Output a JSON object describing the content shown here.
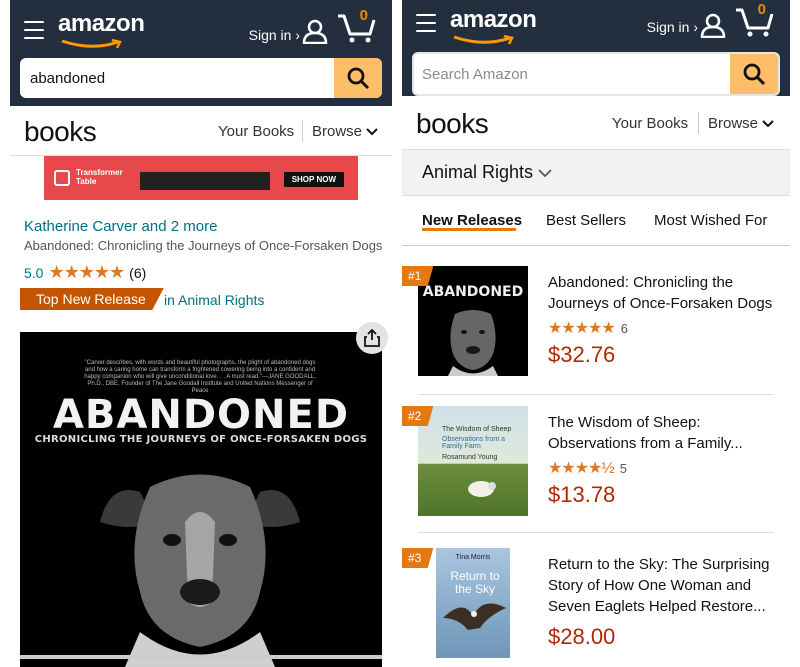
{
  "left": {
    "header": {
      "logo": "amazon",
      "signin": "Sign in ›",
      "cart_count": "0"
    },
    "search": {
      "value": "abandoned"
    },
    "booksbar": {
      "logo": "books",
      "your_books": "Your Books",
      "browse": "Browse"
    },
    "ad": {
      "brand": "Transformer Table",
      "shop": "SHOP NOW"
    },
    "product": {
      "author": "Katherine Carver and 2 more",
      "title": "Abandoned: Chronicling the Journeys of Once-Forsaken Dogs",
      "rating": "5.0",
      "stars": "★★★★★",
      "review_count": "(6)",
      "badge": "Top New Release",
      "badge_category": "in Animal Rights"
    },
    "cover": {
      "quote": "\"Carver describes, with words and beautiful photographs, the plight of abandoned dogs and how a caring home can transform a frightened cowering being into a confident and happy companion who will give unconditional love. . . A must read.\"—JANE GOODALL, Ph.D., DBE, Founder of The Jane Goodall Institute and United Nations Messenger of Peace",
      "title": "ABANDONED",
      "subtitle": "CHRONICLING THE JOURNEYS OF ONCE-FORSAKEN DOGS"
    }
  },
  "right": {
    "header": {
      "logo": "amazon",
      "signin": "Sign in ›",
      "cart_count": "0"
    },
    "search": {
      "placeholder": "Search Amazon"
    },
    "booksbar": {
      "logo": "books",
      "your_books": "Your Books",
      "browse": "Browse"
    },
    "category": "Animal Rights",
    "tabs": [
      "New Releases",
      "Best Sellers",
      "Most Wished For"
    ],
    "items": [
      {
        "rank": "#1",
        "title": "Abandoned: Chronicling the Journeys of Once-Forsaken Dogs",
        "stars": "★★★★★",
        "count": "6",
        "price": "$32.76"
      },
      {
        "rank": "#2",
        "title": "The Wisdom of Sheep: Observations from a Family...",
        "stars": "★★★★½",
        "count": "5",
        "price": "$13.78"
      },
      {
        "rank": "#3",
        "title": "Return to the Sky: The Surprising Story of How One Woman and Seven Eaglets Helped Restore...",
        "stars": "",
        "count": "",
        "price": "$28.00"
      }
    ],
    "thumbs": {
      "t1_title": "ABANDONED",
      "t2_title": "The Wisdom of Sheep",
      "t2_sub": "Observations from a Family Farm",
      "t2_author": "Rosamund Young",
      "t3_author": "Tina Morris",
      "t3_title": "Return to the Sky"
    }
  },
  "colors": {
    "header_bg": "#232f3e",
    "search_btn": "#febd69",
    "badge": "#c45500",
    "link": "#007185",
    "price": "#b12704",
    "star": "#de7921"
  }
}
